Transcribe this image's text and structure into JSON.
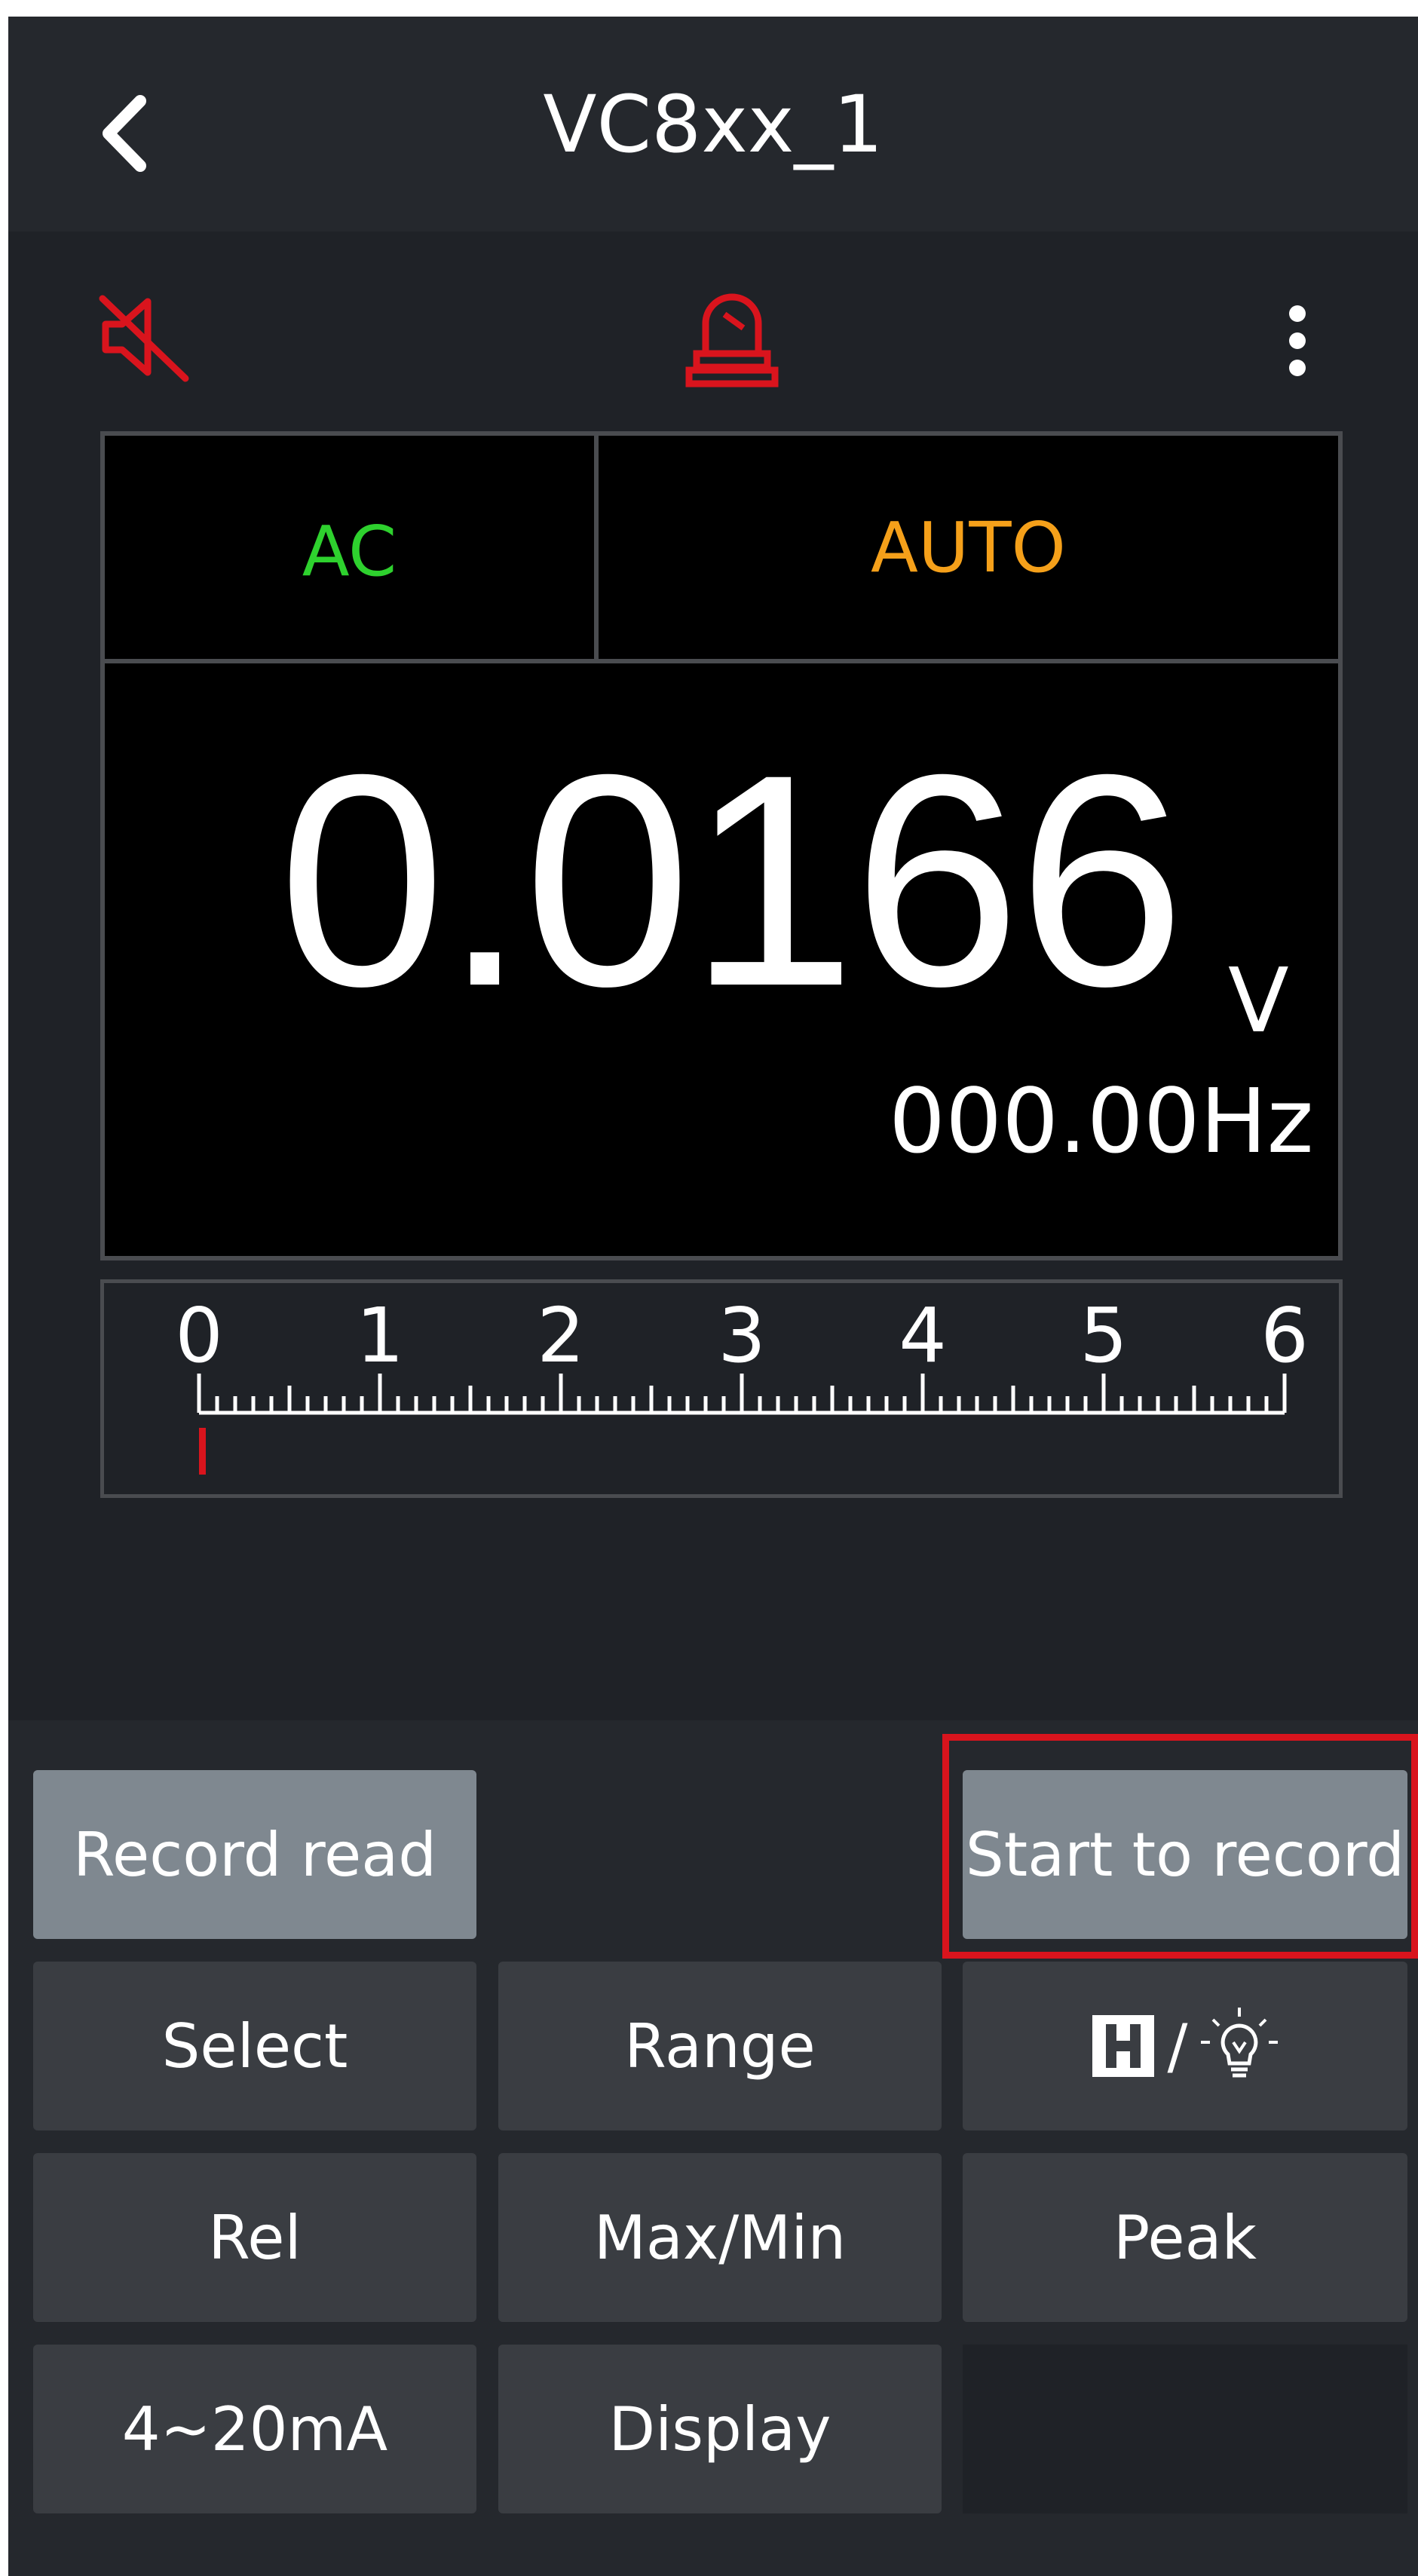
{
  "header": {
    "title": "VC8xx_1"
  },
  "icons": {
    "back": "chevron-left-icon",
    "mute": "speaker-muted-icon",
    "hold": "hold-lamp-icon",
    "more": "more-vertical-icon"
  },
  "colors": {
    "accent_red": "#d9141d",
    "ac_green": "#2ed12e",
    "auto_orange": "#f5a01a"
  },
  "display": {
    "mode": "AC",
    "range": "AUTO",
    "reading": "0.0166",
    "unit": "V",
    "frequency": "000.00Hz"
  },
  "scale": {
    "labels": [
      "0",
      "1",
      "2",
      "3",
      "4",
      "5",
      "6"
    ],
    "pointer_value": 0.0166
  },
  "buttons": {
    "record_read": "Record read",
    "start_record": "Start to record",
    "select": "Select",
    "range": "Range",
    "hold_light": "H / light",
    "rel": "Rel",
    "maxmin": "Max/Min",
    "peak": "Peak",
    "current_loop": "4~20mA",
    "display": "Display"
  }
}
